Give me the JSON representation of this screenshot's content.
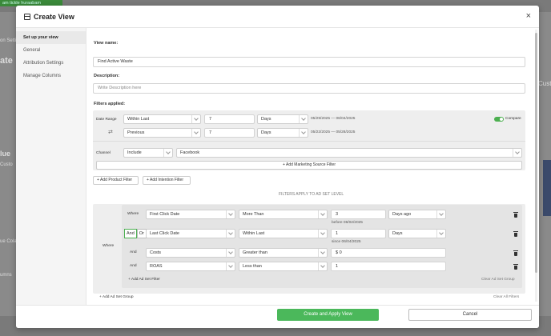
{
  "background": {
    "green_banner": "am tickle huraabam",
    "left_texts": [
      "on Setti",
      "ate",
      "lue",
      "Custo",
      "ue Cola",
      "umns"
    ],
    "right_texts": [
      "Custo"
    ]
  },
  "modal": {
    "title": "Create View",
    "close": "×"
  },
  "sidebar": {
    "items": [
      {
        "label": "Set up your view"
      },
      {
        "label": "General"
      },
      {
        "label": "Attribution Settings"
      },
      {
        "label": "Manage Columns"
      }
    ]
  },
  "form": {
    "view_name_label": "View name:",
    "view_name_value": "Find Active Waste",
    "description_label": "Description:",
    "description_placeholder": "Write Description here",
    "filters_label": "Filters applied:",
    "date_range": {
      "label": "Date Range",
      "row1": {
        "mode": "Within Last",
        "value": "7",
        "unit": "Days",
        "range": "05/29/2025 — 06/04/2025"
      },
      "row2": {
        "mode": "Previous",
        "value": "7",
        "unit": "Days",
        "range": "05/22/2025 — 05/28/2025"
      },
      "compare_label": "Compare"
    },
    "channel": {
      "label": "Channel",
      "mode": "Include",
      "value": "Facebook"
    },
    "add_marketing_source": "+ Add Marketing Source Filter",
    "add_product_filter": "+ Add Product Filter",
    "add_intention_filter": "+ Add Intention Filter",
    "filters_note": "FILTERS APPLY TO AD SET LEVEL",
    "adset": {
      "where_outer": "Where",
      "rows": [
        {
          "prefix": "Where",
          "field": "First Click Date",
          "op": "More Than",
          "value": "3",
          "unit": "Days ago",
          "sub": "before 06/02/2025"
        },
        {
          "prefix": "",
          "field": "Last Click Date",
          "op": "Within Last",
          "value": "1",
          "unit": "Days",
          "sub": "since 06/04/2025"
        },
        {
          "prefix": "And",
          "field": "Costs",
          "op": "Greater than",
          "value": "$ 0"
        },
        {
          "prefix": "And",
          "field": "ROAS",
          "op": "Less than",
          "value": "1"
        }
      ],
      "and_label": "And",
      "or_label": "Or",
      "add_filter": "+ Add Ad Set Filter",
      "clear_group": "Clear Ad Set Group"
    },
    "add_group": "+ Add Ad Set Group",
    "clear_all": "Clear All Filters"
  },
  "footer": {
    "primary": "Create and Apply View",
    "cancel": "Cancel"
  }
}
